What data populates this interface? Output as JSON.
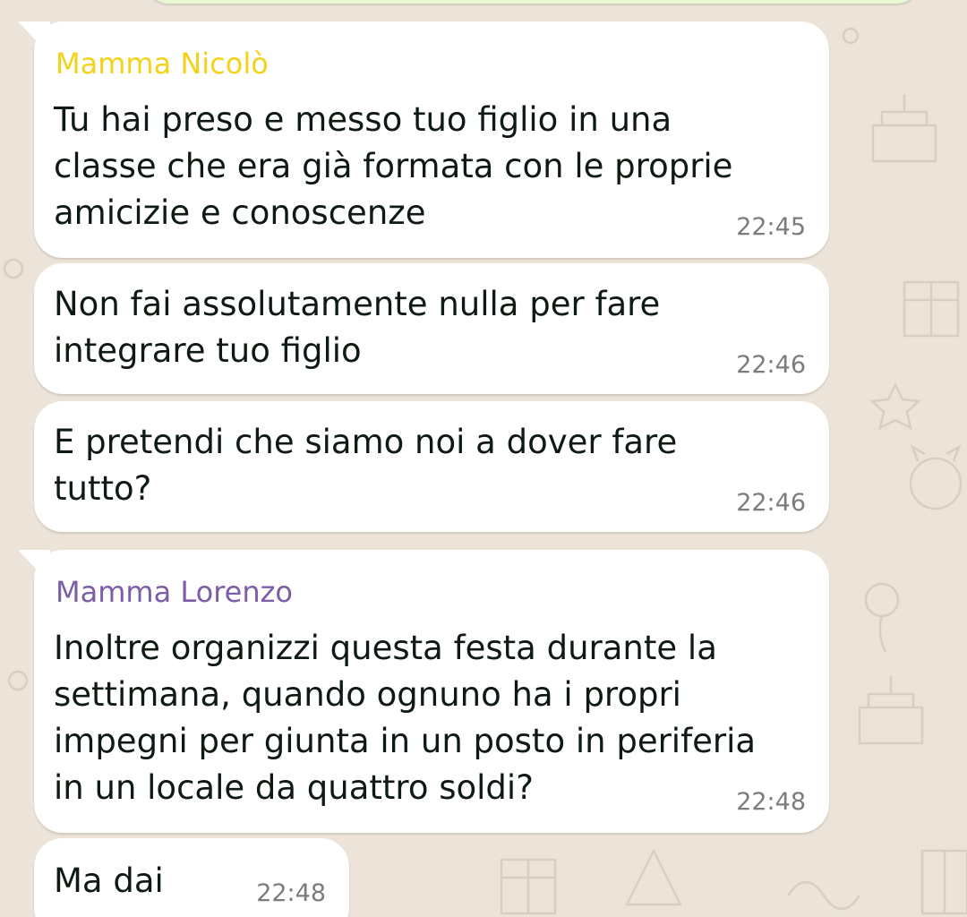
{
  "colors": {
    "background": "#ece4d9",
    "bubble": "#ffffff",
    "sender_nicolo": "#f3d21a",
    "sender_lorenzo": "#7b5ea7",
    "timestamp": "#7a7d80"
  },
  "messages": [
    {
      "sender": "Mamma Nicolò",
      "lines": [
        "Tu hai preso e messo tuo figlio in una",
        "classe che era già formata con le proprie",
        "amicizie e conoscenze"
      ],
      "time": "22:45"
    },
    {
      "lines": [
        "Non fai assolutamente nulla per fare",
        "integrare tuo figlio"
      ],
      "time": "22:46"
    },
    {
      "lines": [
        "E pretendi che siamo noi a dover fare",
        "tutto?"
      ],
      "time": "22:46"
    },
    {
      "sender": "Mamma Lorenzo",
      "lines": [
        "Inoltre organizzi questa festa durante la",
        "settimana, quando ognuno ha i propri",
        "impegni per giunta in un posto in periferia",
        "in un locale da quattro soldi?"
      ],
      "time": "22:48"
    },
    {
      "lines": [
        "Ma dai"
      ],
      "time": "22:48"
    }
  ]
}
